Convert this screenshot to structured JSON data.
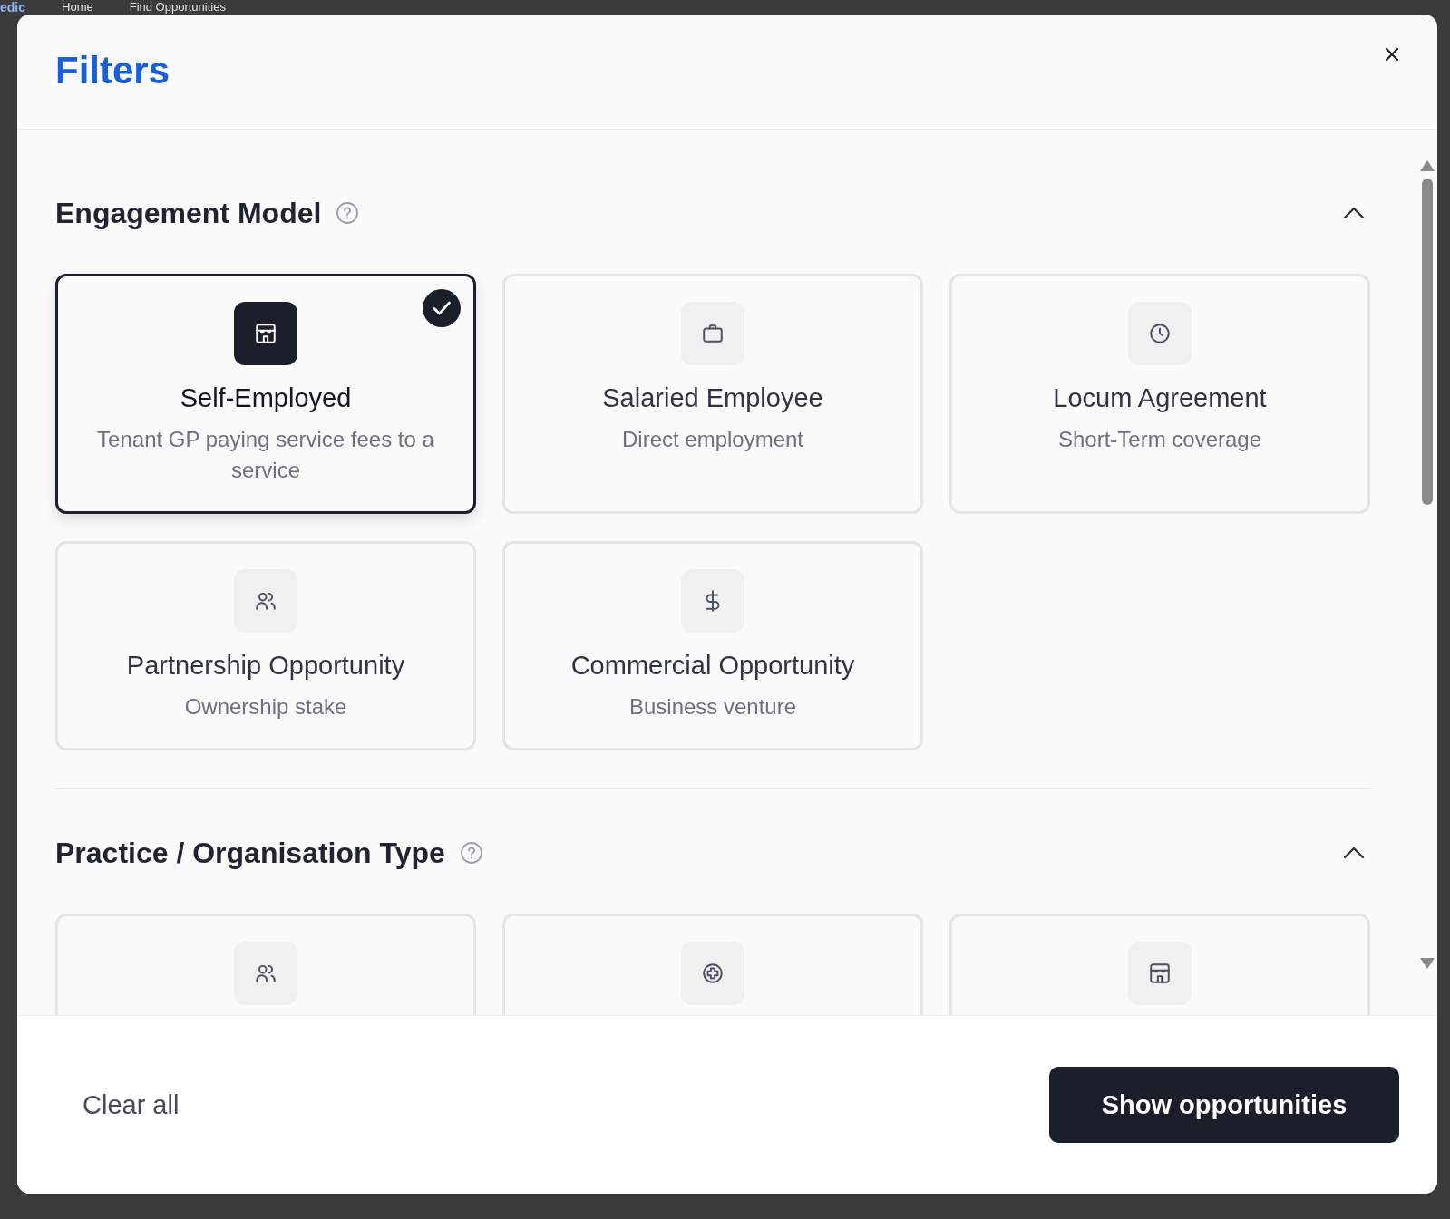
{
  "background": {
    "logo": "edic",
    "nav": [
      "Home",
      "Find Opportunities"
    ]
  },
  "dialog": {
    "title": "Filters",
    "sections": [
      {
        "title": "Engagement Model",
        "expanded": true,
        "options": [
          {
            "kind": "store",
            "label": "Self-Employed",
            "description": "Tenant GP paying service fees to a service",
            "selected": true
          },
          {
            "kind": "briefcase",
            "label": "Salaried Employee",
            "description": "Direct employment",
            "selected": false
          },
          {
            "kind": "clock",
            "label": "Locum Agreement",
            "description": "Short-Term coverage",
            "selected": false
          },
          {
            "kind": "users",
            "label": "Partnership Opportunity",
            "description": "Ownership stake",
            "selected": false
          },
          {
            "kind": "dollar",
            "label": "Commercial Opportunity",
            "description": "Business venture",
            "selected": false
          }
        ]
      },
      {
        "title": "Practice / Organisation Type",
        "expanded": true,
        "options": [
          {
            "kind": "users",
            "selected": false
          },
          {
            "kind": "plus-circle",
            "selected": false
          },
          {
            "kind": "store",
            "selected": false
          }
        ]
      }
    ],
    "clear_button": "Clear all",
    "submit_button": "Show opportunities"
  }
}
